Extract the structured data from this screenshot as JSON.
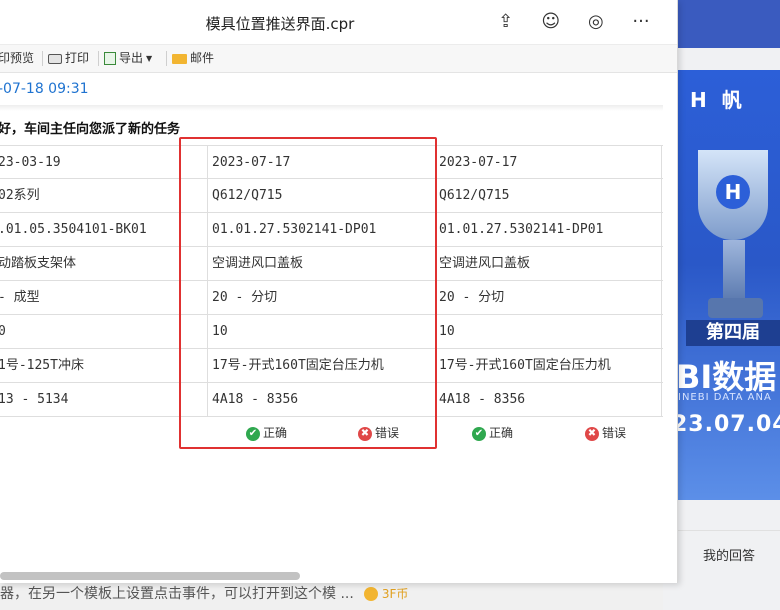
{
  "window": {
    "title": "模具位置推送界面.cpr"
  },
  "toolbar": {
    "print_preview": "印预览",
    "print": "打印",
    "export": "导出",
    "mail": "邮件"
  },
  "timestamp": "-07-18 09:31",
  "greeting": "好，车间主任向您派了新的任务",
  "columns": [
    {
      "date": "23-03-19",
      "series": "02系列",
      "code": ".01.05.3504101-BK01",
      "name": "动踏板支架体",
      "process": " - 成型",
      "count": "0",
      "machine": "1号-125T冲床",
      "location": "13 - 5134"
    },
    {
      "date": "2023-07-17",
      "series": "Q612/Q715",
      "code": "01.01.27.5302141-DP01",
      "name": "空调进风口盖板",
      "process": "20 - 分切",
      "count": "10",
      "machine": "17号-开式160T固定台压力机",
      "location": "4A18 - 8356"
    },
    {
      "date": "2023-07-17",
      "series": "Q612/Q715",
      "code": "01.01.27.5302141-DP01",
      "name": "空调进风口盖板",
      "process": "20 - 分切",
      "count": "10",
      "machine": "17号-开式160T固定台压力机",
      "location": "4A18 - 8356"
    }
  ],
  "actions": {
    "correct": "正确",
    "wrong": "错误"
  },
  "background": {
    "brand": "帆",
    "banner": "第四届",
    "bi_title": "BI数据",
    "bi_sub": "INEBI DATA ANA",
    "date": "23.07.04",
    "my_answer": "我的回答",
    "bottom_text": "器，在另一个模板上设置点击事件，可以打开到这个模 ...",
    "coin_text": "3F币"
  },
  "colors": {
    "highlight": "#e03131",
    "link_blue": "#1f73d0",
    "ok_green": "#2fa84f",
    "err_red": "#e04848"
  }
}
